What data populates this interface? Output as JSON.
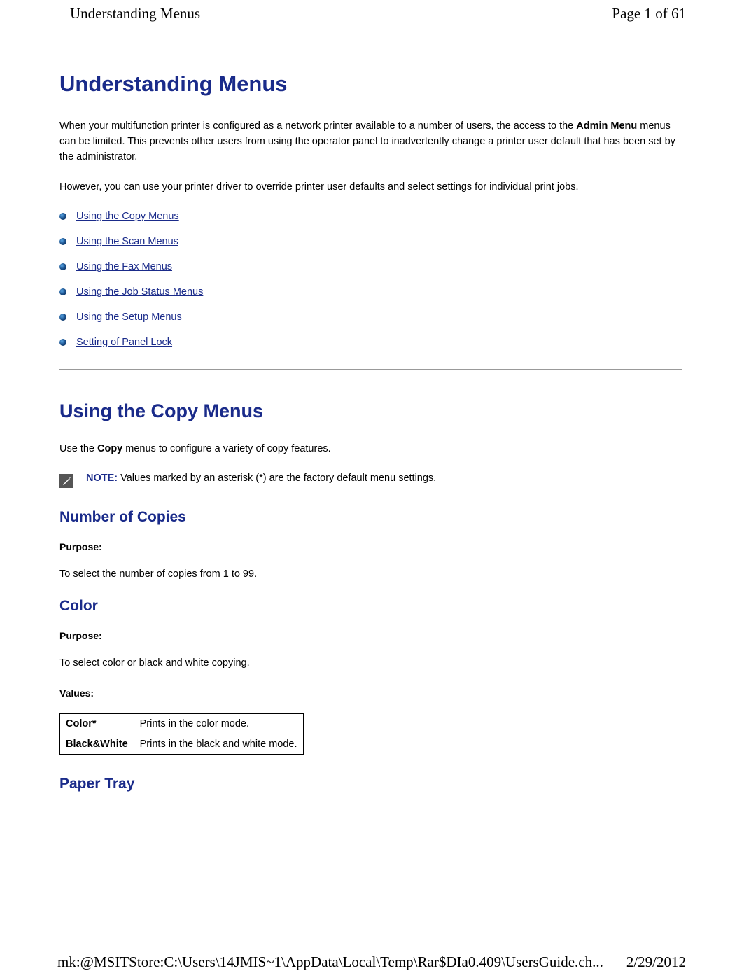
{
  "header": {
    "title_left": "Understanding Menus",
    "page_indicator": "Page 1 of 61"
  },
  "main": {
    "title": "Understanding Menus",
    "intro_p1_a": "When your multifunction printer is configured as a network printer available to a number of users, the access to the ",
    "intro_p1_bold": "Admin Menu",
    "intro_p1_b": " menus can be limited. This prevents other users from using the operator panel to inadvertently change a printer user default that has been set by the administrator.",
    "intro_p2": "However, you can use your printer driver to override printer user defaults and select settings for individual print jobs.",
    "links": [
      "Using the Copy Menus",
      "Using the Scan Menus",
      "Using the Fax Menus",
      "Using the Job Status Menus",
      "Using the Setup Menus",
      "Setting of Panel Lock"
    ],
    "copy_section": {
      "heading": "Using the Copy Menus",
      "intro_a": "Use the ",
      "intro_bold": "Copy",
      "intro_b": " menus to configure a variety of copy features.",
      "note_label": "NOTE:",
      "note_text": " Values marked by an asterisk (*) are the factory default menu settings.",
      "number_of_copies": {
        "heading": "Number of Copies",
        "purpose_label": "Purpose:",
        "purpose_text": "To select the number of copies from 1 to 99."
      },
      "color": {
        "heading": "Color",
        "purpose_label": "Purpose:",
        "purpose_text": "To select color or black and white copying.",
        "values_label": "Values:",
        "table": [
          {
            "name": "Color*",
            "desc": "Prints in the color mode."
          },
          {
            "name": "Black&White",
            "desc": "Prints in the black and white mode."
          }
        ]
      },
      "paper_tray": {
        "heading": "Paper Tray"
      }
    }
  },
  "footer": {
    "path": "mk:@MSITStore:C:\\Users\\14JMIS~1\\AppData\\Local\\Temp\\Rar$DIa0.409\\UsersGuide.ch...",
    "date": "2/29/2012"
  }
}
